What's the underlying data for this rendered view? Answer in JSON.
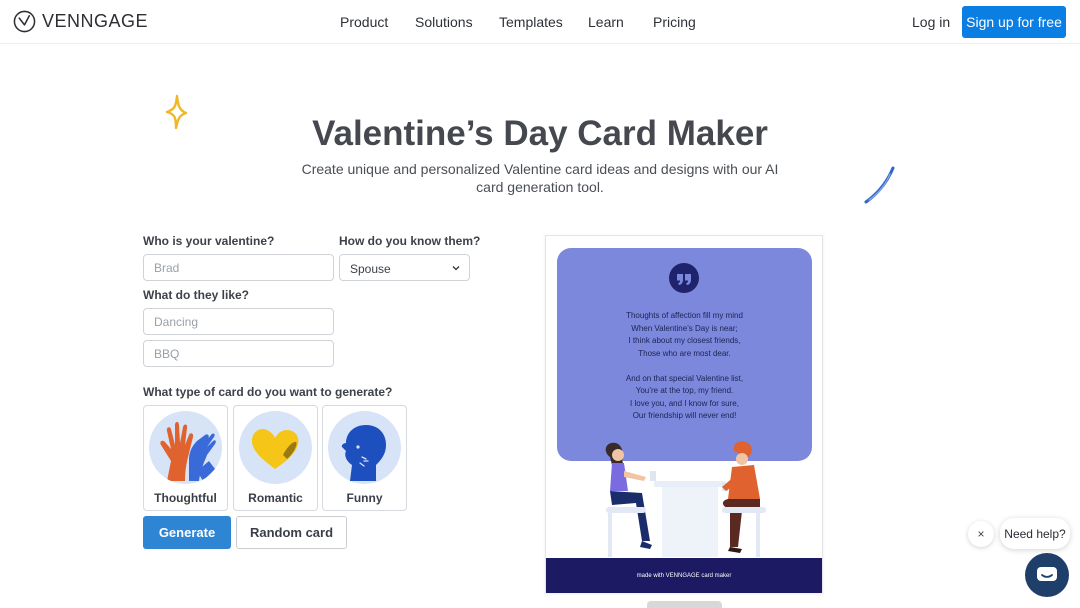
{
  "nav": {
    "brand": "VENNGAGE",
    "links": [
      {
        "label": "Product"
      },
      {
        "label": "Solutions"
      },
      {
        "label": "Templates"
      },
      {
        "label": "Learn"
      },
      {
        "label": "Pricing"
      }
    ],
    "login": "Log in",
    "signup": "Sign up for free"
  },
  "hero": {
    "title": "Valentine’s Day Card Maker",
    "subtitle": "Create unique and personalized Valentine card ideas and designs with our AI card generation tool."
  },
  "form": {
    "who_label": "Who is your valentine?",
    "who_placeholder": "Brad",
    "relation_label": "How do you know them?",
    "relation_value": "Spouse",
    "likes_label": "What do they like?",
    "like1_placeholder": "Dancing",
    "like2_placeholder": "BBQ",
    "type_label": "What type of card do you want to generate?",
    "types": [
      {
        "label": "Thoughtful",
        "icon": "high-five-icon"
      },
      {
        "label": "Romantic",
        "icon": "heart-icon"
      },
      {
        "label": "Funny",
        "icon": "laughing-head-icon"
      }
    ],
    "generate": "Generate",
    "random": "Random card"
  },
  "card": {
    "poem": [
      "Thoughts of affection fill my mind",
      "When Valentine’s Day is near;",
      "I think about my closest friends,",
      "Those who are most dear.",
      "",
      "And on that special Valentine list,",
      "You’re at the top, my friend.",
      "I love you, and I know for sure,",
      "Our friendship will never end!"
    ],
    "footer": "made with VENNGAGE card maker",
    "bubble_color": "#7b88dc",
    "footer_color": "#1c1a63"
  },
  "chat": {
    "close": "×",
    "help": "Need help?"
  },
  "colors": {
    "accent": "#0a7ee3",
    "generate": "#2d85d3"
  }
}
